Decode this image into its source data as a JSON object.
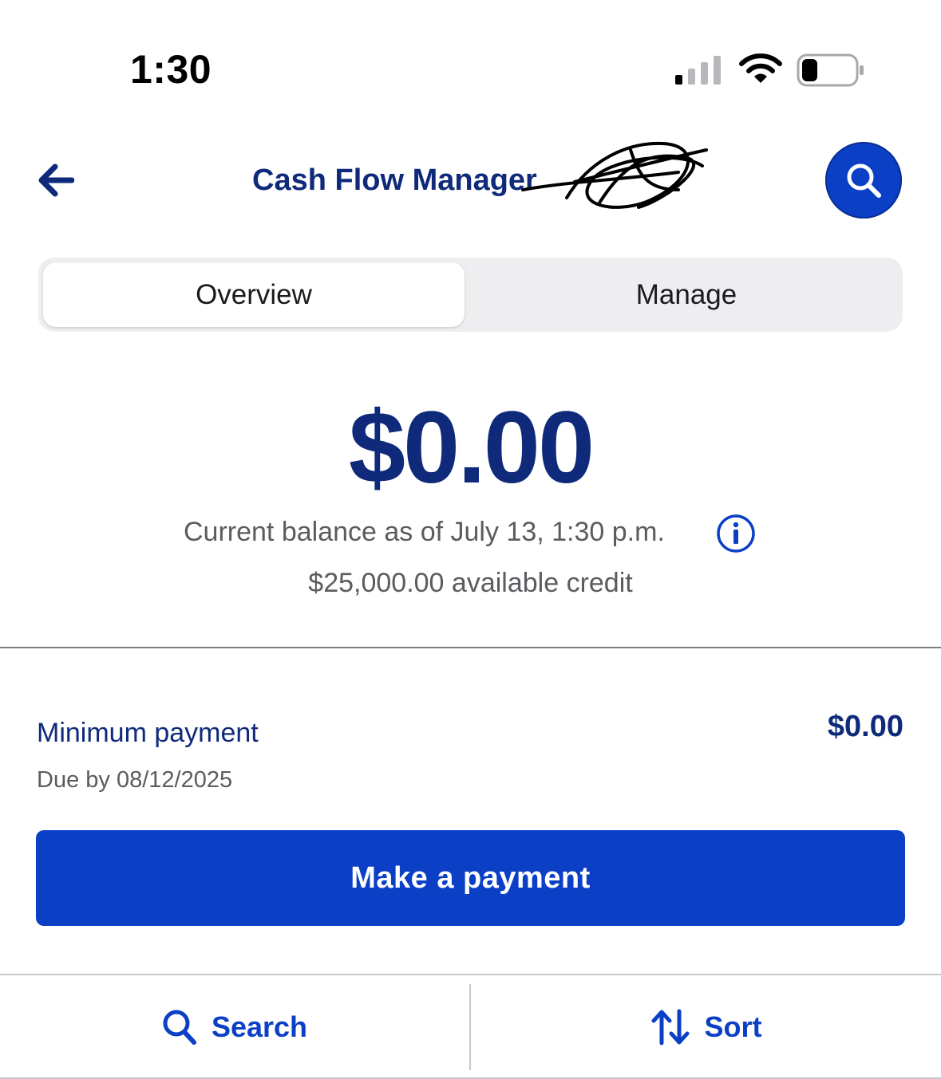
{
  "status_bar": {
    "time": "1:30",
    "signal_icon": "cellular-signal-icon",
    "wifi_icon": "wifi-icon",
    "battery_icon": "battery-low-icon"
  },
  "header": {
    "title": "Cash Flow Manager",
    "back_icon": "arrow-left-icon",
    "search_icon": "search-icon"
  },
  "tabs": [
    {
      "label": "Overview",
      "selected": true
    },
    {
      "label": "Manage",
      "selected": false
    }
  ],
  "balance": {
    "amount": "$0.00",
    "subtitle": "Current balance as of July 13, 1:30 p.m.",
    "info_icon": "info-icon",
    "available_credit": "$25,000.00 available credit"
  },
  "minimum_payment": {
    "label": "Minimum payment",
    "amount": "$0.00",
    "due": "Due by 08/12/2025"
  },
  "actions": {
    "make_payment": "Make a payment"
  },
  "bottom_bar": {
    "search_label": "Search",
    "sort_label": "Sort",
    "search_icon": "search-icon",
    "sort_icon": "sort-arrows-icon"
  },
  "colors": {
    "brand_blue": "#0b3fc6",
    "navy_text": "#0f2a7a",
    "muted_text": "#5b5b60"
  }
}
